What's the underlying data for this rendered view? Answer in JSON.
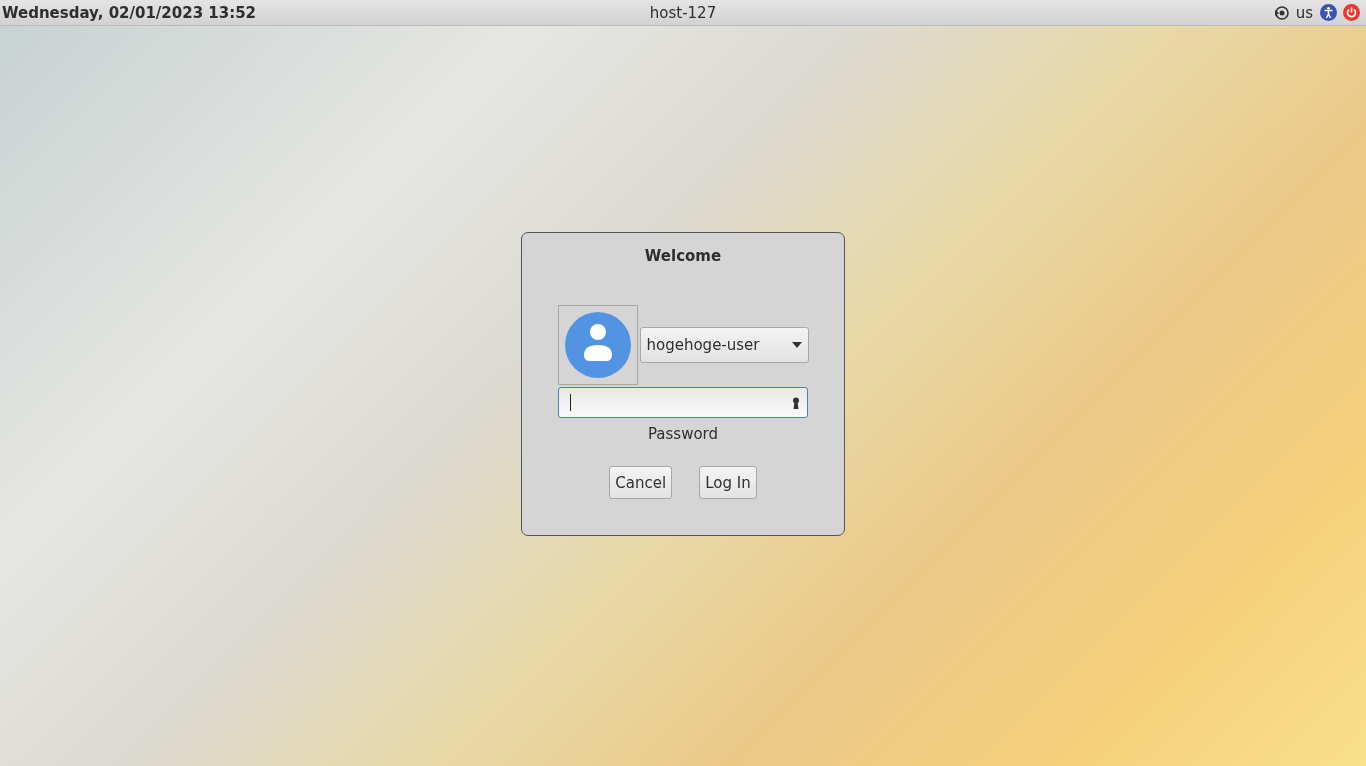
{
  "top_bar": {
    "datetime": "Wednesday, 02/01/2023 13:52",
    "hostname": "host-127",
    "keyboard_layout": "us"
  },
  "dialog": {
    "title": "Welcome",
    "user": "hogehoge-user",
    "password_label": "Password",
    "buttons": [
      "Cancel",
      "Log In"
    ]
  }
}
